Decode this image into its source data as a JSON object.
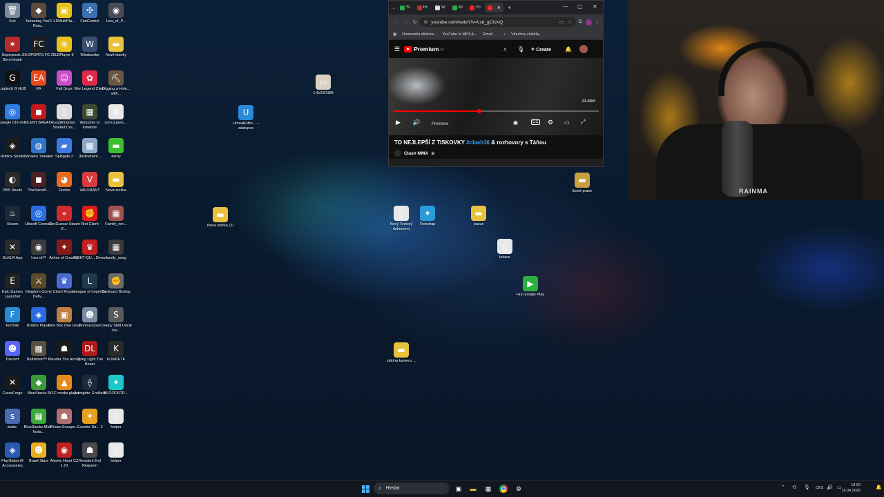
{
  "desktop_icons": [
    {
      "label": "Koš",
      "color": "#7a8a99",
      "glyph": "🗑"
    },
    {
      "label": "Someday You'll Retu...",
      "color": "#5c4a3c",
      "glyph": "◆"
    },
    {
      "label": "LDMultiPla...",
      "color": "#e8c21a",
      "glyph": "▣"
    },
    {
      "label": "FanControl",
      "color": "#3a6fb0",
      "glyph": "✣"
    },
    {
      "label": "Lies_of_P...",
      "color": "#4a4a55",
      "glyph": "◉"
    },
    {
      "label": "Superposit... Benchmark",
      "color": "#b52a2a",
      "glyph": "✶"
    },
    {
      "label": "EA SPORTS FC 26",
      "color": "#1e1e1e",
      "glyph": "FC"
    },
    {
      "label": "LDPlayer 9",
      "color": "#e8c21a",
      "glyph": "⊕"
    },
    {
      "label": "Windscribe",
      "color": "#3a4d70",
      "glyph": "W"
    },
    {
      "label": "Nové ikonky",
      "color": "#e8c13d",
      "glyph": "▬"
    },
    {
      "label": "Logitech G HUB",
      "color": "#111111",
      "glyph": "G"
    },
    {
      "label": "EA",
      "color": "#e84a1c",
      "glyph": "EA"
    },
    {
      "label": "Fall Guys",
      "color": "#c84fc8",
      "glyph": "☺"
    },
    {
      "label": "War Legend Client",
      "color": "#e02a4a",
      "glyph": "✿"
    },
    {
      "label": "Digging a Hole... with...",
      "color": "#6b5740",
      "glyph": "⛏"
    },
    {
      "label": "Google Chrome",
      "color": "#2f7de0",
      "glyph": "◎"
    },
    {
      "label": "SILENT BREATH",
      "color": "#c11a1a",
      "glyph": "◼"
    },
    {
      "label": "LogWindows Started Cra...",
      "color": "#dddddd",
      "glyph": "▯"
    },
    {
      "label": "Welcome to Kowloon",
      "color": "#3b4b30",
      "glyph": "▦"
    },
    {
      "label": "com.superc...",
      "color": "#e8e8e8",
      "glyph": "⚙"
    },
    {
      "label": "Roblox Studio",
      "color": "#1c1c1c",
      "glyph": "◈"
    },
    {
      "label": "Winaero Tweaker",
      "color": "#2f75c7",
      "glyph": "◍"
    },
    {
      "label": "Splitgate 2",
      "color": "#3b7ae0",
      "glyph": "▰"
    },
    {
      "label": "(Instrument...",
      "color": "#8ea8c8",
      "glyph": "▩"
    },
    {
      "label": "alerty",
      "color": "#3bbf2b",
      "glyph": "▬"
    },
    {
      "label": "OBS Studio",
      "color": "#2a2a2a",
      "glyph": "◐"
    },
    {
      "label": "TheSilentS...",
      "color": "#4a2020",
      "glyph": "◼"
    },
    {
      "label": "Firefox",
      "color": "#e66a1a",
      "glyph": "◕"
    },
    {
      "label": "VALORANT",
      "color": "#d93c3c",
      "glyph": "V"
    },
    {
      "label": "Nová složka",
      "color": "#e8c13d",
      "glyph": "▬"
    },
    {
      "label": "Steam",
      "color": "#1b2838",
      "glyph": "♨"
    },
    {
      "label": "Ubisoft Connect",
      "color": "#2a6de0",
      "glyph": "◎"
    },
    {
      "label": "GeoGuessr Steam E...",
      "color": "#d02a2a",
      "glyph": "⌖"
    },
    {
      "label": "Riot Client",
      "color": "#e01a1a",
      "glyph": "✊"
    },
    {
      "label": "Family_ren...",
      "color": "#a05050",
      "glyph": "▦"
    },
    {
      "label": "GoXLR App",
      "color": "#2a2a2a",
      "glyph": "✕"
    },
    {
      "label": "Lies of P",
      "color": "#3a3a3a",
      "glyph": "◉"
    },
    {
      "label": "Ashes of Creation",
      "color": "#8a1a1a",
      "glyph": "✦"
    },
    {
      "label": "FIGHT-QU... Demo",
      "color": "#c02020",
      "glyph": "♛"
    },
    {
      "label": "family_song",
      "color": "#3a3a3a",
      "glyph": "▦"
    },
    {
      "label": "Epic Games Launcher",
      "color": "#222222",
      "glyph": "E"
    },
    {
      "label": "Kingdom Come Deliv...",
      "color": "#5a4a2a",
      "glyph": "⚔"
    },
    {
      "label": "Clash Royale",
      "color": "#4a6ad0",
      "glyph": "♛"
    },
    {
      "label": "League of Legends",
      "color": "#1f3a4a",
      "glyph": "L"
    },
    {
      "label": "Backyard Boxing",
      "color": "#6a6a6a",
      "glyph": "✊"
    },
    {
      "label": "Fortnite",
      "color": "#2a8ad8",
      "glyph": "F"
    },
    {
      "label": "Roblox Player",
      "color": "#2a6ae0",
      "glyph": "◈"
    },
    {
      "label": "One Box One Goal",
      "color": "#c08040",
      "glyph": "▣"
    },
    {
      "label": "MyVoiceZoo",
      "color": "#7a8aa0",
      "glyph": "☻"
    },
    {
      "label": "Creepy Shift Uncle Joe...",
      "color": "#5a5a5a",
      "glyph": "S"
    },
    {
      "label": "Discord",
      "color": "#5865f2",
      "glyph": "☻"
    },
    {
      "label": "Battlefield™ 6",
      "color": "#5a5040",
      "glyph": "▦"
    },
    {
      "label": "Slender The Arrival",
      "color": "#1a1a1a",
      "glyph": "☗"
    },
    {
      "label": "Dying Light The Beast",
      "color": "#b01a1a",
      "glyph": "DL"
    },
    {
      "label": "KOMPETE",
      "color": "#2a2a2a",
      "glyph": "K"
    },
    {
      "label": "CurseForge",
      "color": "#1a1a1a",
      "glyph": "✕"
    },
    {
      "label": "BlueStacks 5",
      "color": "#3a9a3a",
      "glyph": "◆"
    },
    {
      "label": "VLC media player",
      "color": "#e88a1a",
      "glyph": "▲"
    },
    {
      "label": "Arknights: Endfield",
      "color": "#1a2a3a",
      "glyph": "⟠"
    },
    {
      "label": "BLOODSTR...",
      "color": "#1ac8c8",
      "glyph": "✦"
    },
    {
      "label": "skate.",
      "color": "#4a6ab0",
      "glyph": "s"
    },
    {
      "label": "BlueStacks Multi-Insta...",
      "color": "#3aa83a",
      "glyph": "▦"
    },
    {
      "label": "Prison Escape...",
      "color": "#b07070",
      "glyph": "☗"
    },
    {
      "label": "Counter-Str... 2",
      "color": "#e8a020",
      "glyph": "✦"
    },
    {
      "label": "helper",
      "color": "#e8e8e8",
      "glyph": "▯"
    },
    {
      "label": "PlayStation® Accessories",
      "color": "#2a5ab0",
      "glyph": "◈"
    },
    {
      "label": "Brawl Stars",
      "color": "#e8b020",
      "glyph": "☻"
    },
    {
      "label": "Atomic Heart CZ 1.70",
      "color": "#c02020",
      "glyph": "◉"
    },
    {
      "label": "Resident Evil Requiem",
      "color": "#4a4a4a",
      "glyph": "☗"
    },
    {
      "label": "helper",
      "color": "#e8e8e8",
      "glyph": "▯"
    }
  ],
  "floating_icons": [
    {
      "label": "1-8d197d68",
      "color": "#d8d0c0",
      "glyph": "▭"
    },
    {
      "label": "UnrealEdito... – zástupce",
      "color": "#2a8ad8",
      "glyph": "U"
    },
    {
      "label": "Nová složka (2)",
      "color": "#e8c13d",
      "glyph": "▬"
    },
    {
      "label": "Nový Textový dokument",
      "color": "#e8e8e8",
      "glyph": "▯"
    },
    {
      "label": "Fishstrap",
      "color": "#2a9ad8",
      "glyph": "✦"
    },
    {
      "label": "pasus",
      "color": "#e8c13d",
      "glyph": "▬"
    },
    {
      "label": "lokace",
      "color": "#e8e8e8",
      "glyph": "▯"
    },
    {
      "label": "Hry Google Play",
      "color": "#2ab040",
      "glyph": "▶"
    },
    {
      "label": "záloha kamera ...",
      "color": "#e8c13d",
      "glyph": "▬"
    },
    {
      "label": "tlusté prase",
      "color": "#c8a040",
      "glyph": "▬"
    }
  ],
  "browser": {
    "tabs": [
      {
        "label": "St",
        "color": "#2ab04a",
        "active": false
      },
      {
        "label": "Hc",
        "color": "#c03030",
        "active": false
      },
      {
        "label": "W",
        "color": "#dddddd",
        "active": false
      },
      {
        "label": "Mi",
        "color": "#2ab04a",
        "active": false
      },
      {
        "label": "Yo",
        "color": "#ff2020",
        "active": false
      },
      {
        "label": "",
        "color": "#ff2020",
        "active": true
      }
    ],
    "url": "youtube.com/watch?v=Lsd_gCtlzvQ",
    "bookmarks": [
      "Domovská stránka...",
      "YouTube to MP4 &...",
      "Gmail",
      "»",
      "Všechny záložky"
    ],
    "yt_brand": "Premium",
    "yt_brand_superscript": "CZ",
    "create_label": "Create",
    "premiere_label": "Premiere",
    "video_watermark": "CLASH",
    "video_title_before": "TO NEJLEPŠÍ Z TISKOVKY ",
    "video_title_hashtag": "#clash16",
    "video_title_after": " & rozhovory s Táňou",
    "channel_name": "Clash MMA"
  },
  "webcam": {
    "brand_text": "RAINMA"
  },
  "taskbar": {
    "search_placeholder": "Hledat",
    "language": "CES",
    "time": "18:50",
    "date": "19.04.2026"
  }
}
